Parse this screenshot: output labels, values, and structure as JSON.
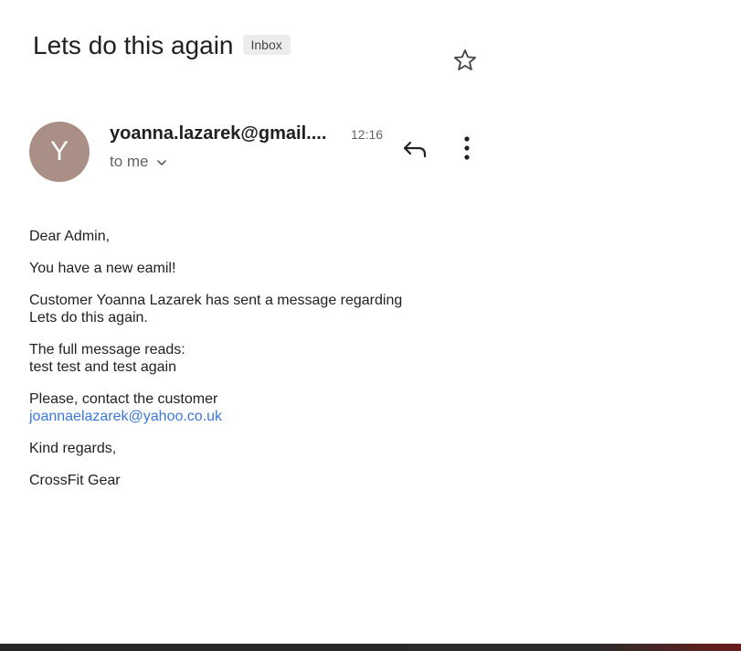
{
  "email": {
    "subject": "Lets do this again",
    "label": "Inbox",
    "avatar_letter": "Y",
    "avatar_color": "#a98f86",
    "sender": "yoanna.lazarek@gmail....",
    "time": "12:16",
    "recipient": "to me",
    "body": {
      "greeting": "Dear Admin,",
      "line1": "You have a new eamil!",
      "line2a": "Customer Yoanna Lazarek has sent a message regarding",
      "line2b": "Lets do this again.",
      "line3a": "The full message reads:",
      "line3b": "test test and test again",
      "line4a": "Please, contact the customer",
      "contact_email": "joannaelazarek@yahoo.co.uk",
      "closing": "Kind regards,",
      "signature": "CrossFit Gear"
    }
  },
  "icons": {
    "star": "star-outline-icon",
    "reply": "reply-icon",
    "more": "more-vert-icon",
    "chevron": "chevron-down-icon"
  },
  "colors": {
    "link": "#3c78d8",
    "secondary_text": "#5f6368",
    "badge_bg": "#ececec"
  }
}
